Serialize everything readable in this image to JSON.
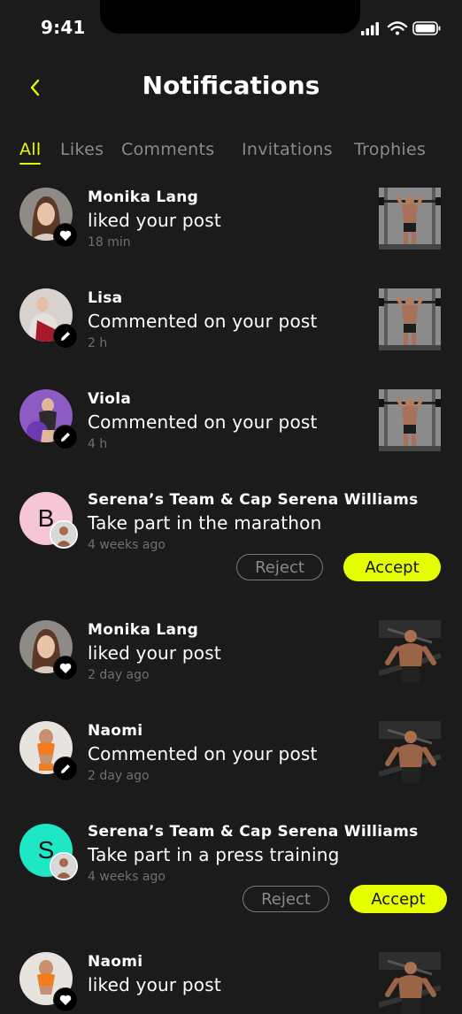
{
  "status": {
    "time": "9:41"
  },
  "header": {
    "title": "Notifications"
  },
  "tabs": [
    "All",
    "Likes",
    "Comments",
    "Invitations",
    "Trophies"
  ],
  "colors": {
    "accent": "#e5ff00",
    "background": "#1b1b1b",
    "muted": "#6f6f6f"
  },
  "notifications": [
    {
      "name": "Monika Lang",
      "action": "liked your post",
      "time": "18 min",
      "badge_icon": "heart-icon"
    },
    {
      "name": "Lisa",
      "action": "Commented on your post",
      "time": "2 h",
      "badge_icon": "pencil-icon"
    },
    {
      "name": "Viola",
      "action": "Commented on your post",
      "time": "4 h",
      "badge_icon": "pencil-icon"
    },
    {
      "name": "Serena’s Team & Cap Serena Williams",
      "action": "Take part in the marathon",
      "time": "4 weeks ago",
      "avatar_letter": "B",
      "avatar_color": "#f7c6d6",
      "reject_label": "Reject",
      "accept_label": "Accept"
    },
    {
      "name": "Monika Lang",
      "action": "liked your post",
      "time": "2 day ago",
      "badge_icon": "heart-icon"
    },
    {
      "name": "Naomi",
      "action": "Commented on your post",
      "time": "2 day ago",
      "badge_icon": "pencil-icon"
    },
    {
      "name": "Serena’s Team & Cap Serena Williams",
      "action": "Take part in a press training",
      "time": "4 weeks ago",
      "avatar_letter": "S",
      "avatar_color": "#1de7c5",
      "reject_label": "Reject",
      "accept_label": "Accept"
    },
    {
      "name": "Naomi",
      "action": "liked your post",
      "time": "",
      "badge_icon": "heart-icon"
    }
  ]
}
